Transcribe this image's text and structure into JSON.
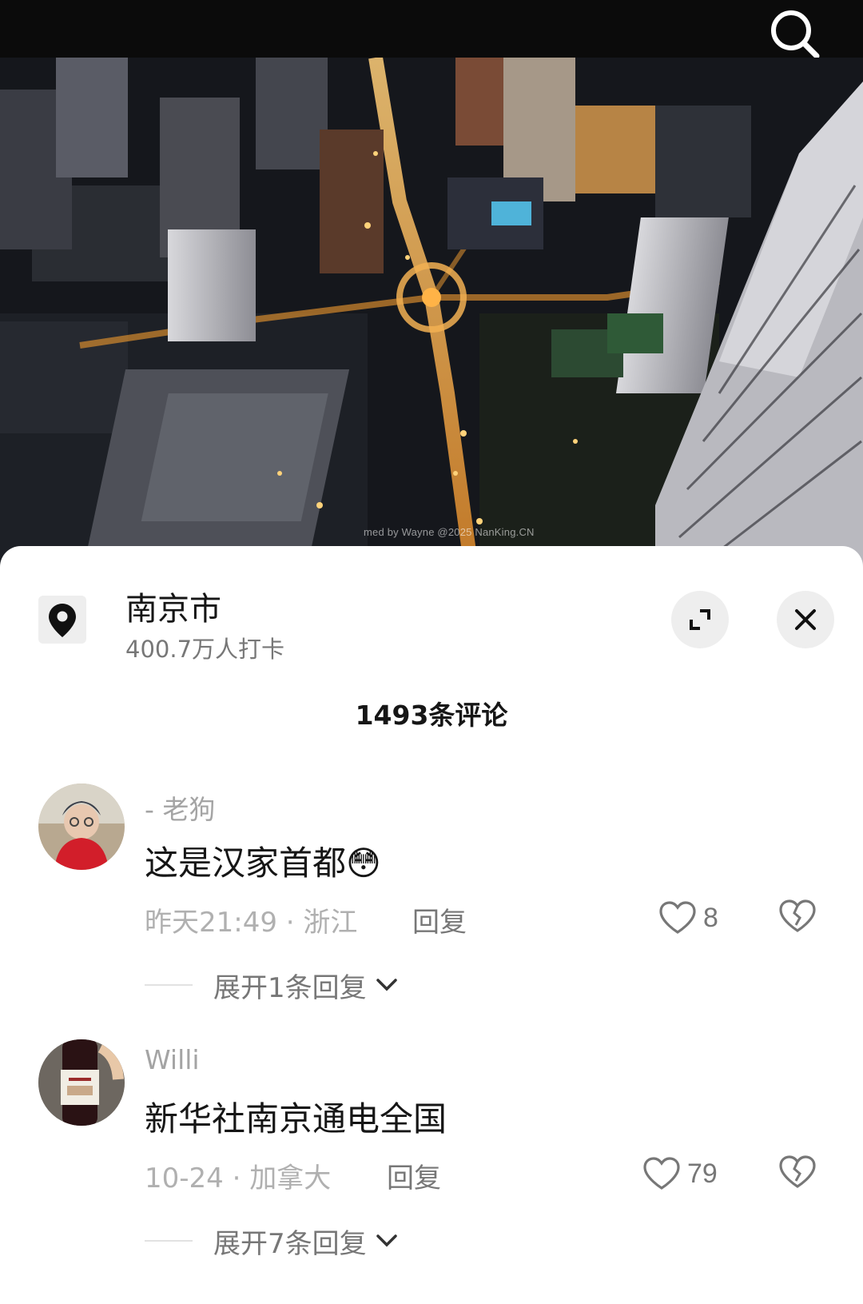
{
  "location": {
    "name": "南京市",
    "checkins": "400.7万人打卡"
  },
  "photo": {
    "watermark": "med by Wayne @2025 NanKing.CN"
  },
  "comments_count": "1493条评论",
  "comments": [
    {
      "username": "- 老狗",
      "text": "这是汉家首都",
      "emoji": "😳",
      "time": "昨天21:49",
      "region": "浙江",
      "reply_label": "回复",
      "likes": "8",
      "expand_label": "展开1条回复"
    },
    {
      "username": "Willi",
      "text": "新华社南京通电全国",
      "time": "10-24",
      "region": "加拿大",
      "reply_label": "回复",
      "likes": "79",
      "expand_label": "展开7条回复"
    }
  ],
  "icons": {
    "search": "search-icon",
    "location": "location-pin-icon",
    "expand": "expand-icon",
    "close": "close-icon",
    "like": "heart-icon",
    "dislike": "broken-heart-icon",
    "chevron": "chevron-down-icon"
  }
}
